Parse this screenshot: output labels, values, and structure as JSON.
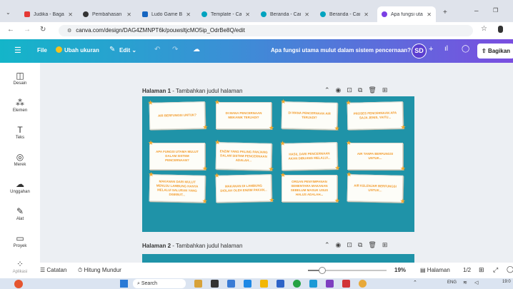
{
  "browser": {
    "tabs": [
      {
        "label": "Judika - Bagaima",
        "color": "#e53935"
      },
      {
        "label": "Pembahasan M",
        "color": "#333333"
      },
      {
        "label": "Ludo Game Boa",
        "color": "#1565c0"
      },
      {
        "label": "Template - Canv",
        "color": "#00a3bf"
      },
      {
        "label": "Beranda - Canva",
        "color": "#00a3bf"
      },
      {
        "label": "Beranda - Canva",
        "color": "#00a3bf"
      },
      {
        "label": "Apa fungsi utam",
        "color": "#7b3fe4"
      }
    ],
    "url": "canva.com/design/DAG4ZMNPT6k/pouwsltjcMO5ip_OdrBe8Q/edit"
  },
  "toolbar": {
    "file": "File",
    "resize": "Ubah ukuran",
    "edit": "Edit",
    "title": "Apa fungsi utama mulut dalam sistem pencernaan?",
    "avatar": "SD",
    "share": "Bagikan"
  },
  "rail": [
    {
      "label": "Desain",
      "icon": "layout-icon"
    },
    {
      "label": "Elemen",
      "icon": "shapes-icon"
    },
    {
      "label": "Teks",
      "icon": "text-icon"
    },
    {
      "label": "Merek",
      "icon": "brand-icon"
    },
    {
      "label": "Unggahan",
      "icon": "upload-icon"
    },
    {
      "label": "Alat",
      "icon": "pen-icon"
    },
    {
      "label": "Proyek",
      "icon": "folder-icon"
    },
    {
      "label": "Aplikasi",
      "icon": "apps-icon"
    }
  ],
  "page1": {
    "label": "Halaman 1",
    "add_title": "- Tambahkan judul halaman",
    "cards": [
      "Air berfungsi untuk?",
      "Di mana pencernaan mekanik terjadi?",
      "Di mana pencernaan air terjadi?",
      "Proses pencernaan apa saja jenis, yaitu...",
      "Apa fungsi utama mulut dalam sistem pencernaan?",
      "Enzim yang paling panjang dalam sistem pencernaan adalah...",
      "Hasil dari pencernaan akan dibuang melalui...",
      "Air tanpa berfungsi untuk...",
      "Makanan dari mulut menuju lambung hanya melalui saluran yang disebut...",
      "Makanan di lambung diolah oleh enzim pakan...",
      "Organ penyimpanan sementara makanan sebelum masuk usus halus adalah...",
      "Air kelenjar berfungsi untuk..."
    ]
  },
  "page2": {
    "label": "Halaman 2",
    "add_title": "- Tambahkan judul halaman"
  },
  "bottom": {
    "notes": "Catatan",
    "timer": "Hitung Mundur",
    "zoom": "19%",
    "pages_label": "Halaman",
    "pages": "1/2"
  },
  "taskbar": {
    "search": "Search",
    "lang": "ENG",
    "time": "19:0"
  }
}
